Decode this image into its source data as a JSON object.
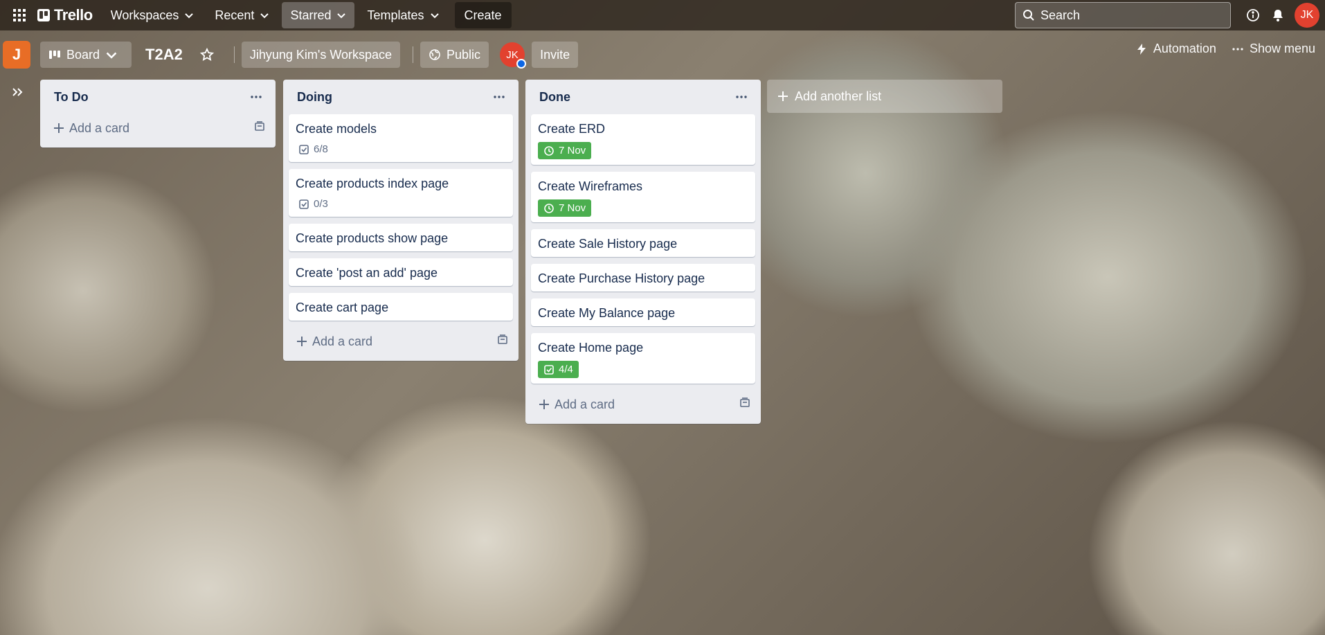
{
  "topnav": {
    "logo": "Trello",
    "items": [
      {
        "label": "Workspaces"
      },
      {
        "label": "Recent"
      },
      {
        "label": "Starred"
      },
      {
        "label": "Templates"
      }
    ],
    "create_label": "Create",
    "search_placeholder": "Search",
    "user_initials": "JK"
  },
  "board": {
    "workspace_badge": "J",
    "view_label": "Board",
    "title": "T2A2",
    "workspace_name": "Jihyung Kim's Workspace",
    "visibility_label": "Public",
    "member_initials": "JK",
    "invite_label": "Invite",
    "automation_label": "Automation",
    "show_menu_label": "Show menu"
  },
  "lists": [
    {
      "title": "To Do",
      "cards": [],
      "add_card_label": "Add a card"
    },
    {
      "title": "Doing",
      "cards": [
        {
          "title": "Create models",
          "checklist": "6/8"
        },
        {
          "title": "Create products index page",
          "checklist": "0/3"
        },
        {
          "title": "Create products show page"
        },
        {
          "title": "Create 'post an add' page"
        },
        {
          "title": "Create cart page"
        }
      ],
      "add_card_label": "Add a card"
    },
    {
      "title": "Done",
      "cards": [
        {
          "title": "Create ERD",
          "due": "7 Nov"
        },
        {
          "title": "Create Wireframes",
          "due": "7 Nov"
        },
        {
          "title": "Create Sale History page"
        },
        {
          "title": "Create Purchase History page"
        },
        {
          "title": "Create My Balance page"
        },
        {
          "title": "Create Home page",
          "checklist_complete": "4/4"
        }
      ],
      "add_card_label": "Add a card"
    }
  ],
  "add_list_label": "Add another list",
  "colors": {
    "due_complete": "#4bae4f",
    "avatar": "#e2412f",
    "workspace_badge": "#e86d26"
  }
}
